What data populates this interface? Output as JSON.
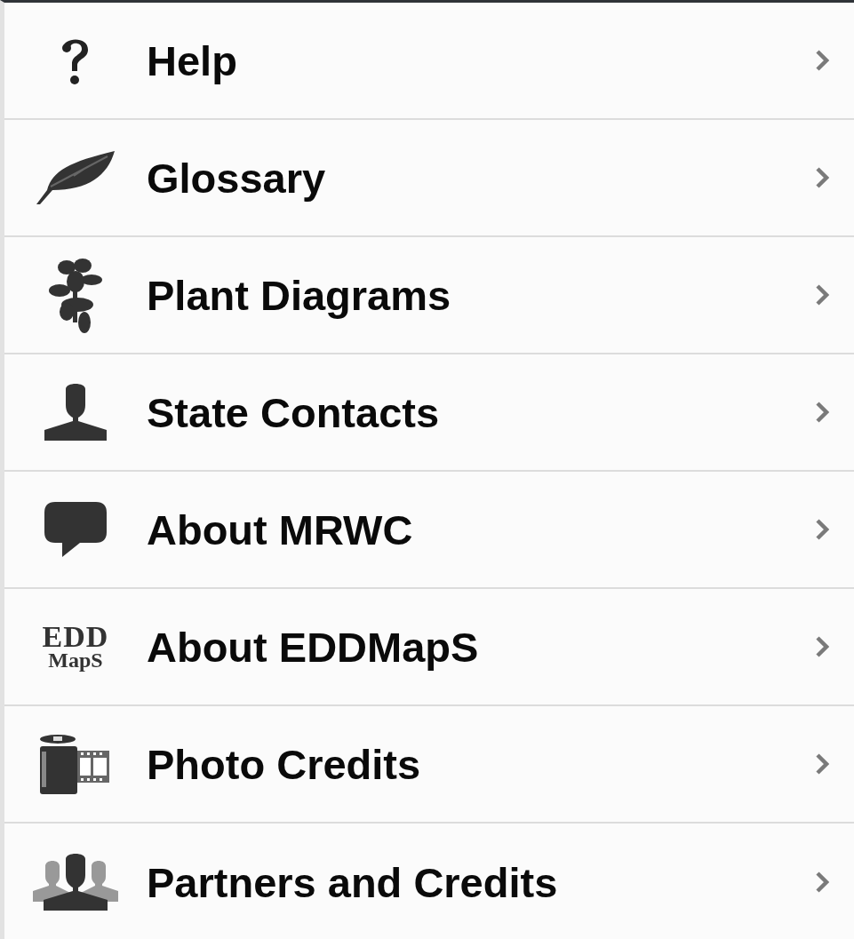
{
  "menu": [
    {
      "label": "Help"
    },
    {
      "label": "Glossary"
    },
    {
      "label": "Plant Diagrams"
    },
    {
      "label": "State Contacts"
    },
    {
      "label": "About MRWC"
    },
    {
      "label": "About EDDMapS",
      "logo_lines": [
        "EDD",
        "MapS"
      ]
    },
    {
      "label": "Photo Credits"
    },
    {
      "label": "Partners and Credits"
    }
  ]
}
